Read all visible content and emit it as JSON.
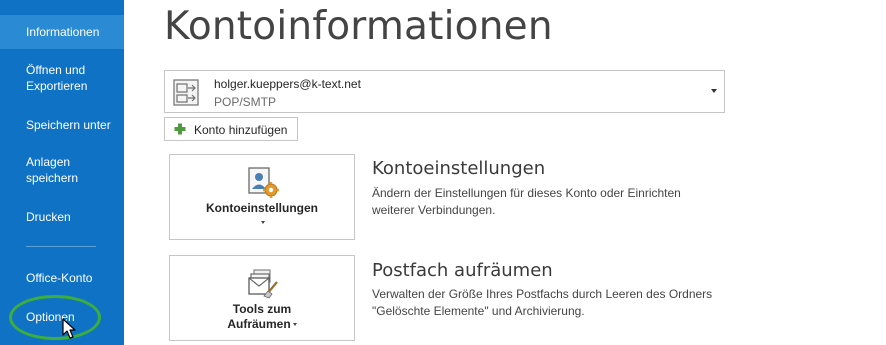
{
  "sidebar": {
    "items": [
      {
        "label": "Informationen"
      },
      {
        "label": "Öffnen und Exportieren"
      },
      {
        "label": "Speichern unter"
      },
      {
        "label": "Anlagen speichern"
      },
      {
        "label": "Drucken"
      },
      {
        "label": "Office-Konto"
      },
      {
        "label": "Optionen"
      }
    ],
    "active_index": 0,
    "background_color": "#1072c4",
    "active_color": "#2a8ad4",
    "highlight_color": "#3cae3c"
  },
  "main": {
    "title": "Kontoinformationen",
    "account": {
      "email": "holger.kueppers@k-text.net",
      "type": "POP/SMTP"
    },
    "add_account_label": "Konto hinzufügen",
    "sections": [
      {
        "button_label": "Kontoeinstellungen",
        "title": "Kontoeinstellungen",
        "description": "Ändern der Einstellungen für dieses Konto oder Einrichten weiterer Verbindungen."
      },
      {
        "button_label_line1": "Tools zum",
        "button_label_line2": "Aufräumen",
        "title": "Postfach aufräumen",
        "description": "Verwalten der Größe Ihres Postfachs durch Leeren des Ordners \"Gelöschte Elemente\" und Archivierung."
      }
    ]
  },
  "icons": {
    "account": "account-card-icon",
    "add": "plus-icon",
    "account_settings": "account-settings-icon",
    "cleanup": "cleanup-tools-icon",
    "cursor": "mouse-pointer-icon"
  }
}
